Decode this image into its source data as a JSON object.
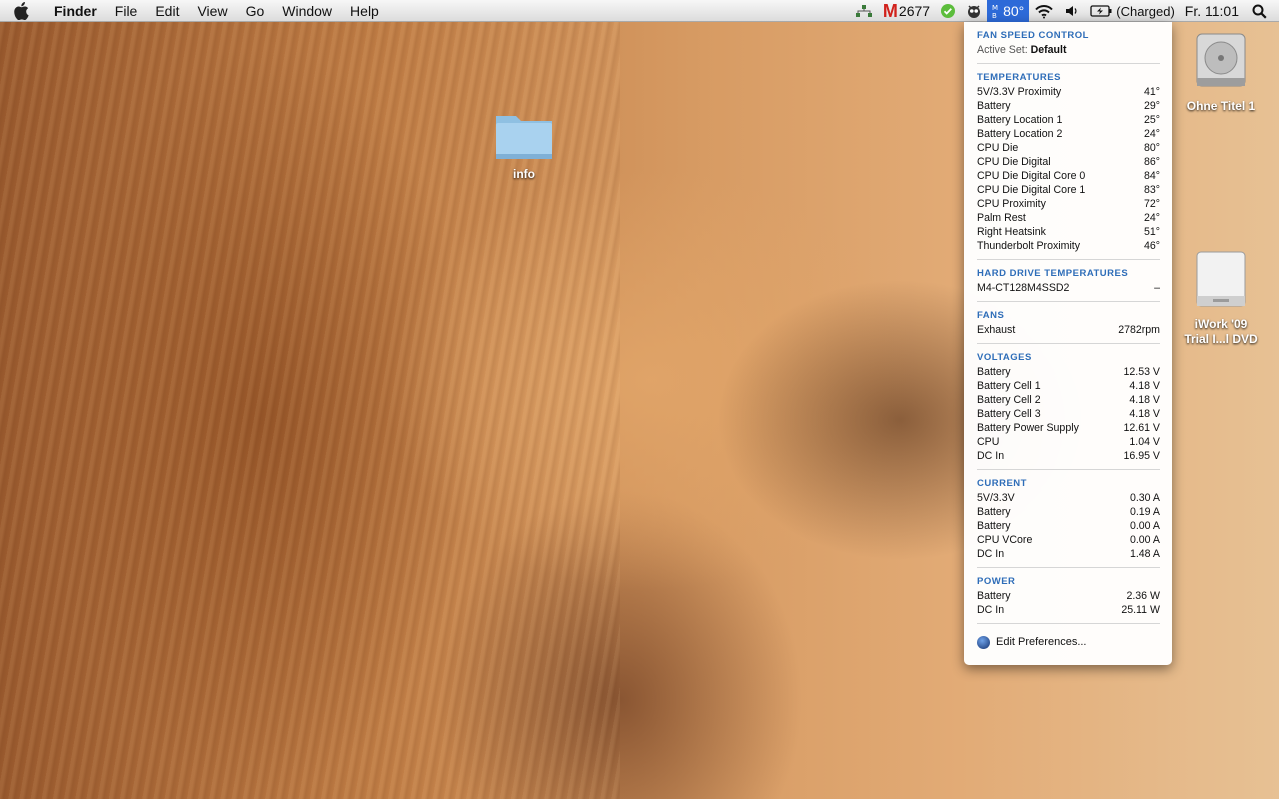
{
  "menubar": {
    "apple_icon": "apple-logo-icon",
    "app_name": "Finder",
    "menus": [
      "File",
      "Edit",
      "View",
      "Go",
      "Window",
      "Help"
    ],
    "status": {
      "gmail_count": "2677",
      "fan_label": "80°",
      "battery_status": "(Charged)",
      "clock": "Fr. 11:01"
    }
  },
  "fan_menu": {
    "header": {
      "title": "FAN SPEED CONTROL",
      "active_set_label": "Active Set:",
      "active_set_value": "Default"
    },
    "temperatures": {
      "title": "TEMPERATURES",
      "rows": [
        {
          "label": "5V/3.3V Proximity",
          "value": "41°"
        },
        {
          "label": "Battery",
          "value": "29°"
        },
        {
          "label": "Battery Location 1",
          "value": "25°"
        },
        {
          "label": "Battery Location 2",
          "value": "24°"
        },
        {
          "label": "CPU Die",
          "value": "80°"
        },
        {
          "label": "CPU Die Digital",
          "value": "86°"
        },
        {
          "label": "CPU Die Digital Core 0",
          "value": "84°"
        },
        {
          "label": "CPU Die Digital Core 1",
          "value": "83°"
        },
        {
          "label": "CPU Proximity",
          "value": "72°"
        },
        {
          "label": "Palm Rest",
          "value": "24°"
        },
        {
          "label": "Right Heatsink",
          "value": "51°"
        },
        {
          "label": "Thunderbolt Proximity",
          "value": "46°"
        }
      ]
    },
    "hdd": {
      "title": "HARD DRIVE TEMPERATURES",
      "rows": [
        {
          "label": "M4-CT128M4SSD2",
          "value": "–"
        }
      ]
    },
    "fans": {
      "title": "FANS",
      "rows": [
        {
          "label": "Exhaust",
          "value": "2782rpm"
        }
      ]
    },
    "voltages": {
      "title": "VOLTAGES",
      "rows": [
        {
          "label": "Battery",
          "value": "12.53 V"
        },
        {
          "label": "Battery Cell 1",
          "value": "4.18 V"
        },
        {
          "label": "Battery Cell 2",
          "value": "4.18 V"
        },
        {
          "label": "Battery Cell 3",
          "value": "4.18 V"
        },
        {
          "label": "Battery Power Supply",
          "value": "12.61 V"
        },
        {
          "label": "CPU",
          "value": "1.04 V"
        },
        {
          "label": "DC In",
          "value": "16.95 V"
        }
      ]
    },
    "current": {
      "title": "CURRENT",
      "rows": [
        {
          "label": "5V/3.3V",
          "value": "0.30 A"
        },
        {
          "label": "Battery",
          "value": "0.19 A"
        },
        {
          "label": "Battery",
          "value": "0.00 A"
        },
        {
          "label": "CPU VCore",
          "value": "0.00 A"
        },
        {
          "label": "DC In",
          "value": "1.48 A"
        }
      ]
    },
    "power": {
      "title": "POWER",
      "rows": [
        {
          "label": "Battery",
          "value": "2.36 W"
        },
        {
          "label": "DC In",
          "value": "25.11 W"
        }
      ]
    },
    "edit_preferences": "Edit Preferences..."
  },
  "desktop": {
    "folder_label": "info",
    "hdd_label": "Ohne Titel 1",
    "dvd_label_line1": "iWork '09",
    "dvd_label_line2": "Trial I...l DVD"
  }
}
